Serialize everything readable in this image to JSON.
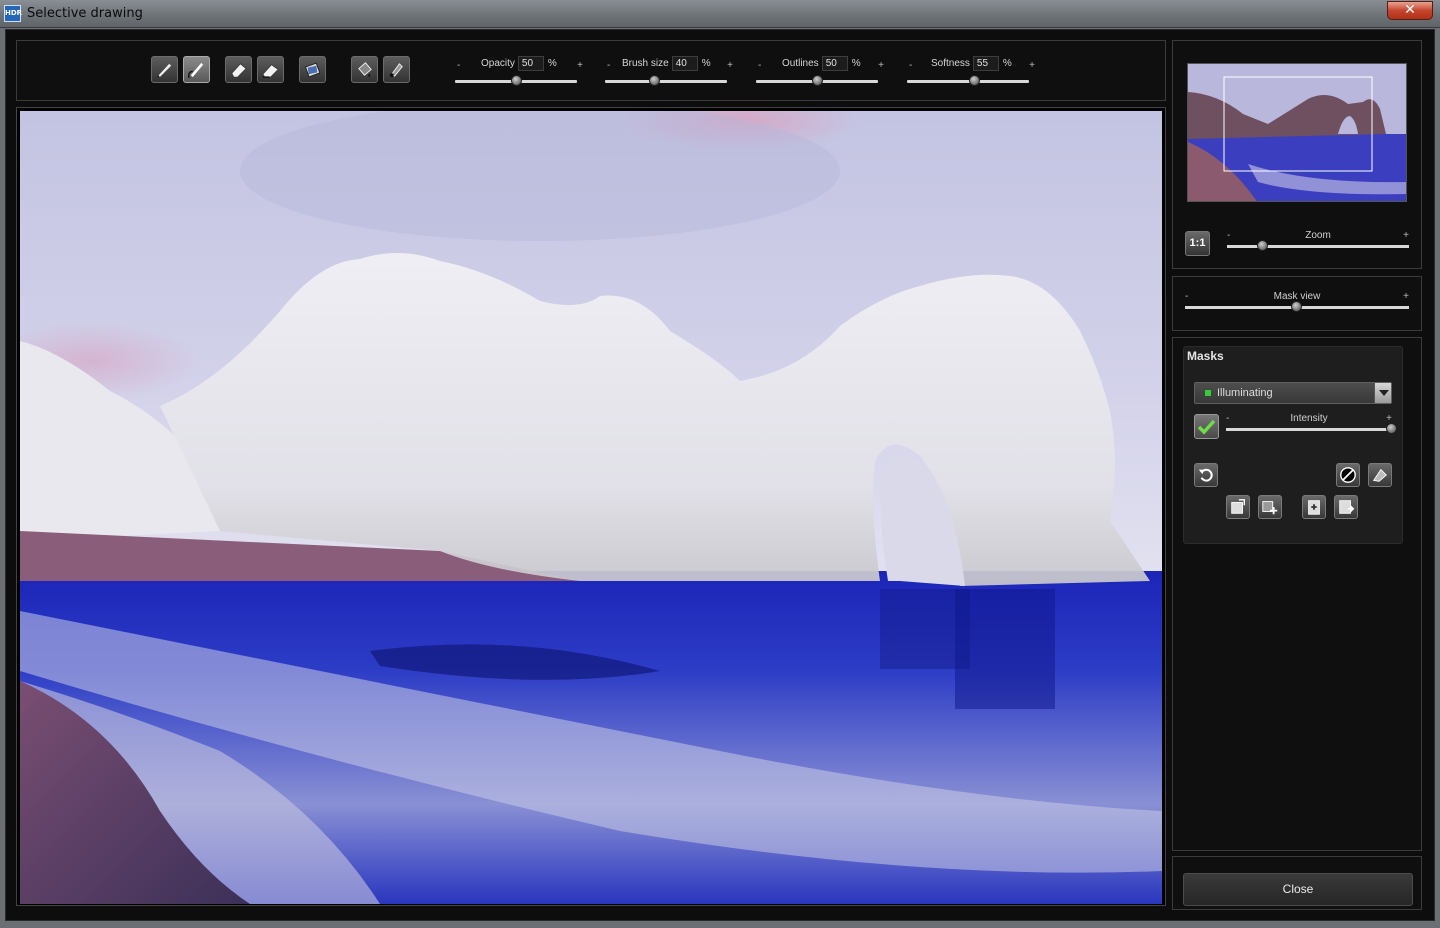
{
  "window": {
    "title": "Selective drawing",
    "app_icon_text": "HDR",
    "close_glyph": "✕"
  },
  "toolbar": {
    "tools": [
      {
        "icon": "brush-icon",
        "active": false
      },
      {
        "icon": "brush-edge-icon",
        "active": true
      },
      {
        "icon": "eraser-icon",
        "active": false
      },
      {
        "icon": "eraser-soft-icon",
        "active": false
      },
      {
        "icon": "fill-eraser-icon",
        "active": false
      },
      {
        "icon": "fill-bucket-icon",
        "active": false
      },
      {
        "icon": "auto-pen-icon",
        "active": false
      }
    ],
    "sliders": [
      {
        "label": "Opacity",
        "value": "50",
        "unit": "%",
        "minus": "-",
        "plus": "+",
        "level": 0.5
      },
      {
        "label": "Brush size",
        "value": "40",
        "unit": "%",
        "minus": "-",
        "plus": "+",
        "level": 0.4
      },
      {
        "label": "Outlines",
        "value": "50",
        "unit": "%",
        "minus": "-",
        "plus": "+",
        "level": 0.5
      },
      {
        "label": "Softness",
        "value": "55",
        "unit": "%",
        "minus": "-",
        "plus": "+",
        "level": 0.55
      }
    ]
  },
  "navigator": {
    "one_to_one_label": "1:1",
    "zoom": {
      "label": "Zoom",
      "minus": "-",
      "plus": "+",
      "level": 0.2
    }
  },
  "mask_view": {
    "label": "Mask view",
    "minus": "-",
    "plus": "+",
    "level": 0.5
  },
  "masks": {
    "title": "Masks",
    "selected_mask": "Illuminating",
    "selected_mask_color": "#2fd13a",
    "intensity": {
      "label": "Intensity",
      "minus": "-",
      "plus": "+",
      "level": 1.0
    }
  },
  "footer": {
    "close_label": "Close"
  }
}
